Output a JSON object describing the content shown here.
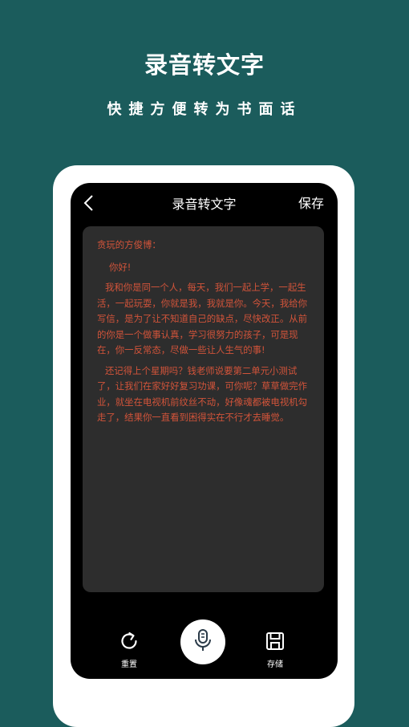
{
  "promo": {
    "title": "录音转文字",
    "subtitle": "快捷方便转为书面话"
  },
  "app": {
    "nav": {
      "back_icon": "chevron-left-icon",
      "title": "录音转文字",
      "save_label": "保存"
    },
    "letter": {
      "salutation": "贪玩的方俊博：",
      "greeting": "你好!",
      "paragraph1": "我和你是同一个人，每天，我们一起上学，一起生活，一起玩耍，你就是我，我就是你。今天，我给你写信，是为了让不知道自己的缺点，尽快改正。从前的你是一个做事认真，学习很努力的孩子，可是现在，你一反常态，尽做一些让人生气的事!",
      "paragraph2": "还记得上个星期吗？钱老师说要第二单元小测试了，让我们在家好好复习功课，可你呢？草草做完作业，就坐在电视机前纹丝不动，好像魂都被电视机勾走了，结果你一直看到困得实在不行才去睡觉。"
    },
    "controls": {
      "reset_label": "重置",
      "reset_icon": "refresh-icon",
      "mic_icon": "microphone-icon",
      "store_label": "存储",
      "store_icon": "floppy-disk-icon"
    },
    "colors": {
      "background": "#1b5c5c",
      "letter_text": "#d2543a",
      "card": "#2d2d2d"
    }
  }
}
